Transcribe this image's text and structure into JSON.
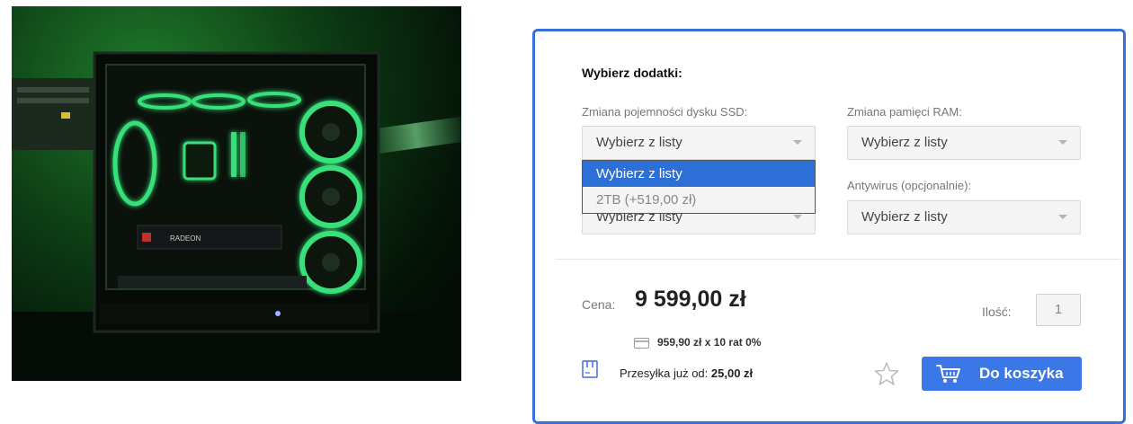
{
  "addons": {
    "title": "Wybierz dodatki:",
    "ssd": {
      "label": "Zmiana pojemności dysku SSD:",
      "value": "Wybierz z listy",
      "options": [
        {
          "label": "Wybierz z listy",
          "selected": true
        },
        {
          "label": "2TB (+519,00 zł)",
          "selected": false
        }
      ]
    },
    "ram": {
      "label": "Zmiana pamięci RAM:",
      "value": "Wybierz z listy"
    },
    "third": {
      "value": "Wybierz z listy"
    },
    "antivirus": {
      "label": "Antywirus (opcjonalnie):",
      "value": "Wybierz z listy"
    }
  },
  "price": {
    "label": "Cena:",
    "value": "9 599,00 zł",
    "installments": "959,90 zł x 10 rat 0%"
  },
  "quantity": {
    "label": "Ilość:",
    "value": "1"
  },
  "shipping": {
    "label": "Przesyłka już od:",
    "value": "25,00 zł"
  },
  "cart": {
    "label": "Do koszyka"
  },
  "product_image": {
    "brand_text": "RADEON"
  },
  "colors": {
    "accent": "#3b6fdc",
    "button": "#3b78e7",
    "selected_option": "#2c6fd6",
    "glow": "#39e07a"
  },
  "icons": {
    "wishlist": "star-outline-icon",
    "cart": "cart-icon",
    "installment": "credit-card-icon",
    "shipping": "package-icon"
  }
}
